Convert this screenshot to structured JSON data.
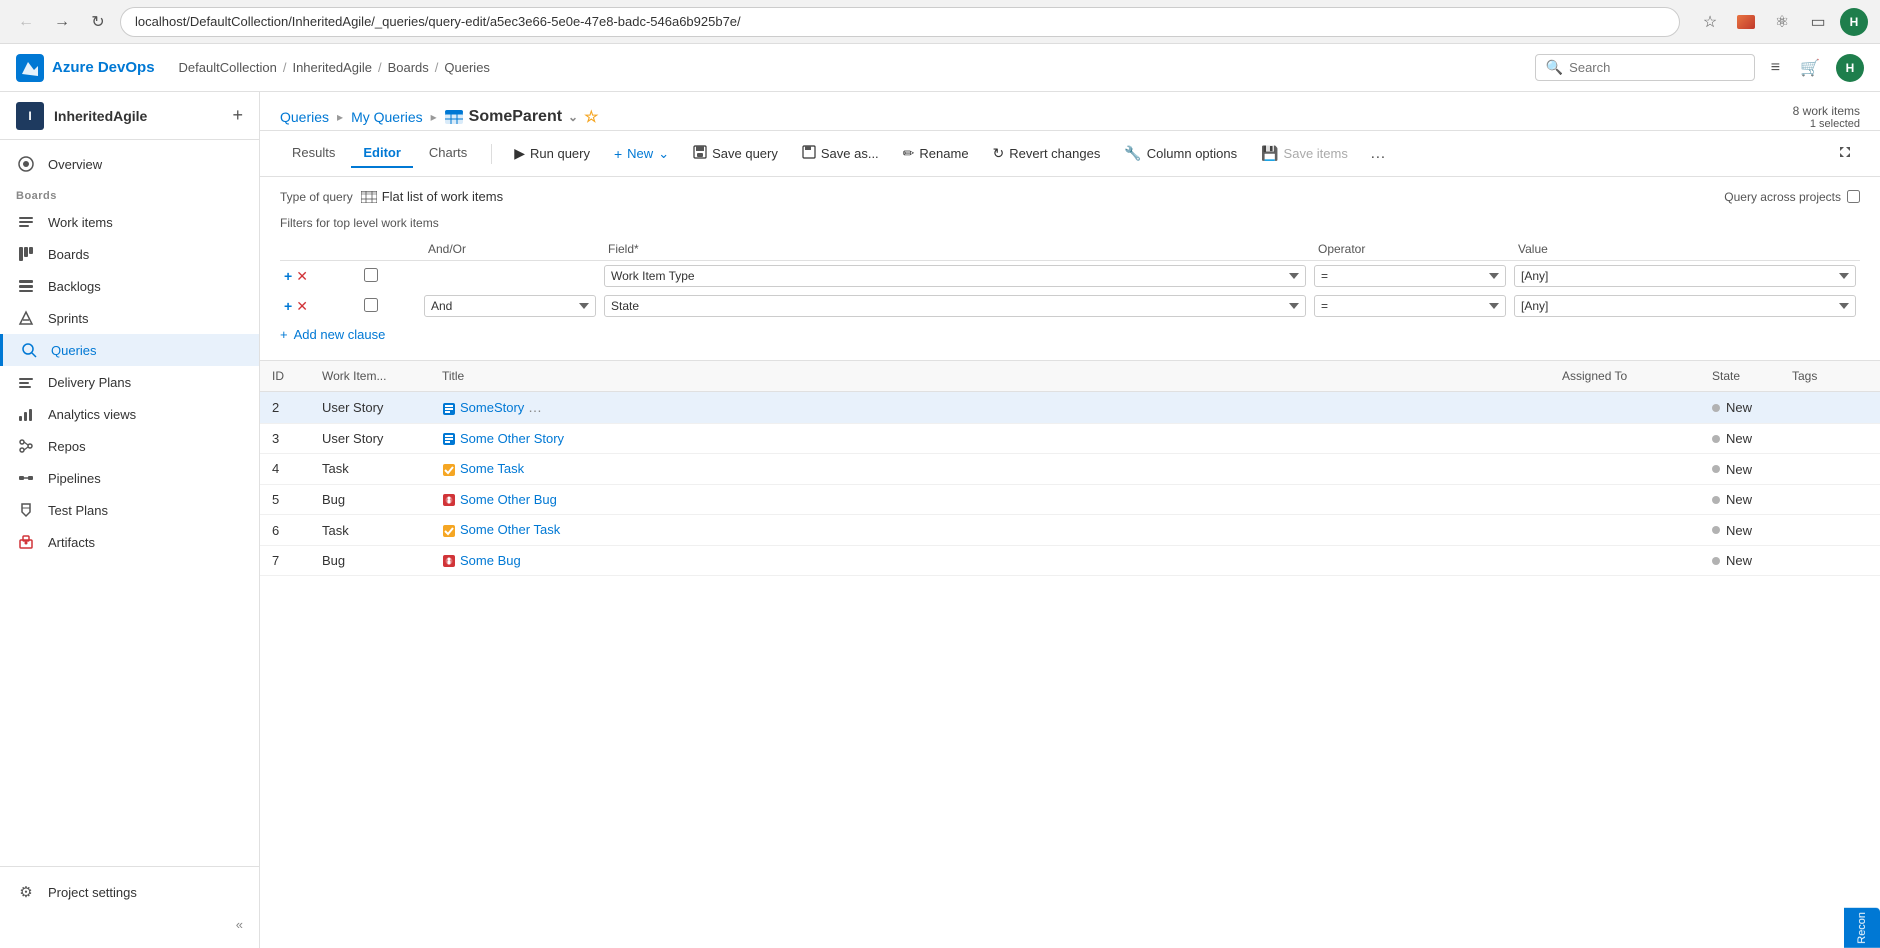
{
  "browser": {
    "url": "localhost/DefaultCollection/InheritedAgile/_queries/query-edit/a5ec3e66-5e0e-47e8-badc-546a6b925b7e/",
    "search_placeholder": "Search"
  },
  "topnav": {
    "logo_text": "Azure DevOps",
    "breadcrumb": [
      "DefaultCollection",
      "/",
      "InheritedAgile",
      "/",
      "Boards",
      "/",
      "Queries"
    ]
  },
  "sidebar": {
    "project_name": "InheritedAgile",
    "project_initial": "I",
    "items": [
      {
        "id": "overview",
        "label": "Overview",
        "icon": "home"
      },
      {
        "id": "boards-section",
        "label": "Boards",
        "icon": "board-section",
        "type": "section"
      },
      {
        "id": "work-items",
        "label": "Work items",
        "icon": "checklist"
      },
      {
        "id": "boards",
        "label": "Boards",
        "icon": "kanban"
      },
      {
        "id": "backlogs",
        "label": "Backlogs",
        "icon": "backlog"
      },
      {
        "id": "sprints",
        "label": "Sprints",
        "icon": "sprint"
      },
      {
        "id": "queries",
        "label": "Queries",
        "icon": "query",
        "active": true
      },
      {
        "id": "delivery-plans",
        "label": "Delivery Plans",
        "icon": "delivery"
      },
      {
        "id": "analytics-views",
        "label": "Analytics views",
        "icon": "analytics"
      },
      {
        "id": "repos",
        "label": "Repos",
        "icon": "repo"
      },
      {
        "id": "pipelines",
        "label": "Pipelines",
        "icon": "pipeline"
      },
      {
        "id": "test-plans",
        "label": "Test Plans",
        "icon": "test"
      },
      {
        "id": "artifacts",
        "label": "Artifacts",
        "icon": "artifact"
      }
    ],
    "footer": {
      "project_settings": "Project settings"
    }
  },
  "page": {
    "breadcrumb": {
      "queries": "Queries",
      "my_queries": "My Queries",
      "current": "SomeParent"
    },
    "work_items_count": "8 work items",
    "selected_count": "1 selected"
  },
  "tabs": {
    "results": "Results",
    "editor": "Editor",
    "charts": "Charts"
  },
  "toolbar": {
    "run_query": "Run query",
    "new": "New",
    "save_query": "Save query",
    "save_as": "Save as...",
    "rename": "Rename",
    "revert_changes": "Revert changes",
    "column_options": "Column options",
    "save_items": "Save items"
  },
  "query_editor": {
    "type_label": "Type of query",
    "type_value": "Flat list of work items",
    "query_across": "Query across projects",
    "filters_label": "Filters for top level work items",
    "columns": {
      "and_or": "And/Or",
      "field": "Field*",
      "operator": "Operator",
      "value": "Value"
    },
    "rows": [
      {
        "and_or": "",
        "field": "Work Item Type",
        "operator": "=",
        "value": "[Any]"
      },
      {
        "and_or": "And",
        "field": "State",
        "operator": "=",
        "value": "[Any]"
      }
    ],
    "add_clause": "Add new clause"
  },
  "results": {
    "columns": [
      "ID",
      "Work Item...",
      "Title",
      "Assigned To",
      "State",
      "Tags"
    ],
    "rows": [
      {
        "id": "2",
        "type": "User Story",
        "type_icon": "story",
        "title": "SomeStory",
        "assigned_to": "",
        "state": "New",
        "tags": "",
        "selected": true,
        "show_ellipsis": true
      },
      {
        "id": "3",
        "type": "User Story",
        "type_icon": "story",
        "title": "Some Other Story",
        "assigned_to": "",
        "state": "New",
        "tags": ""
      },
      {
        "id": "4",
        "type": "Task",
        "type_icon": "task",
        "title": "Some Task",
        "assigned_to": "",
        "state": "New",
        "tags": ""
      },
      {
        "id": "5",
        "type": "Bug",
        "type_icon": "bug",
        "title": "Some Other Bug",
        "assigned_to": "",
        "state": "New",
        "tags": ""
      },
      {
        "id": "6",
        "type": "Task",
        "type_icon": "task",
        "title": "Some Other Task",
        "assigned_to": "",
        "state": "New",
        "tags": ""
      },
      {
        "id": "7",
        "type": "Bug",
        "type_icon": "bug",
        "title": "Some Bug",
        "assigned_to": "",
        "state": "New",
        "tags": ""
      }
    ]
  },
  "recon": "Recon"
}
